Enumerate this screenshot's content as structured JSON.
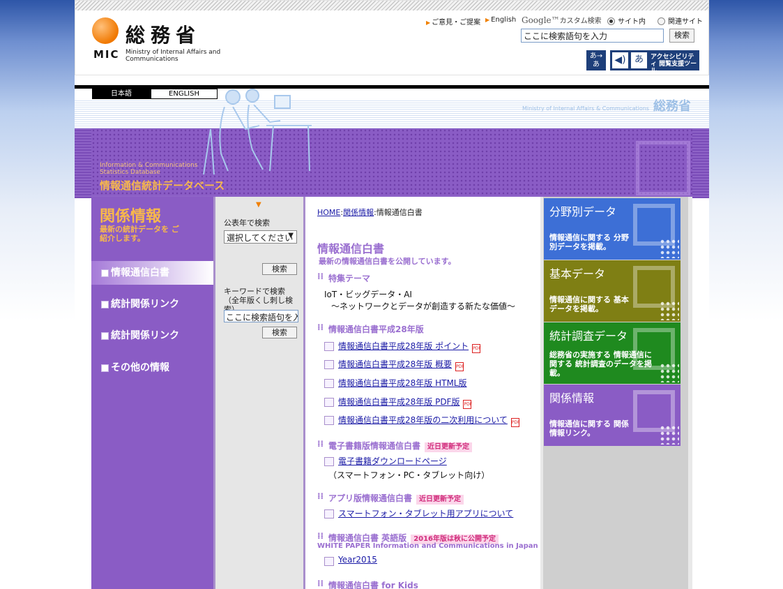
{
  "header": {
    "logo_ja": "総務省",
    "logo_mic": "MIC",
    "logo_en": "Ministry of Internal Affairs and Communications",
    "links": [
      "ご意見・ご提案",
      "English"
    ],
    "google_label": "カスタム検索",
    "google_word": "Google™",
    "radio_site": "サイト内",
    "radio_related": "関連サイト",
    "search_placeholder": "ここに検索語句を入力",
    "search_button": "検索",
    "acc_text_size": "あ→あ",
    "acc_tool": "アクセシビリティ 閲覧支援ツール"
  },
  "banner": {
    "lang_ja": "日本語",
    "lang_en": "ENGLISH",
    "mic_en": "Ministry of Internal Affairs & Communications",
    "mic_ja": "総務省",
    "db_en": "Information & Communications Statistics Database",
    "db_ja": "情報通信統計データベース"
  },
  "left_nav": {
    "title": "関係情報",
    "subtitle": "最新の統計データを ご紹介します。",
    "items": [
      {
        "label": "情報通信白書",
        "active": true
      },
      {
        "label": "統計関係リンク",
        "active": false
      },
      {
        "label": "統計関係リンク",
        "active": false
      },
      {
        "label": "その他の情報",
        "active": false
      }
    ]
  },
  "filter": {
    "year_label": "公表年で検索",
    "year_select": "選択してください",
    "search_button": "検索",
    "keyword_label": "キーワードで検索",
    "keyword_note": "（全年版くし刺し検索）",
    "keyword_placeholder": "ここに検索語句を入力",
    "keyword_button": "検索"
  },
  "content": {
    "breadcrumb": {
      "home": "HOME",
      "sep": ":",
      "rel": "関係情報",
      "current": "情報通信白書"
    },
    "title": "情報通信白書",
    "desc": "最新の情報通信白書を公開しています。",
    "theme_heading": "特集テーマ",
    "theme_line1": "IoT・ビッグデータ・AI",
    "theme_line2": "～ネットワークとデータが創造する新たな価値～",
    "h28_heading": "情報通信白書平成28年版",
    "h28_links": [
      "情報通信白書平成28年版 ポイント",
      "情報通信白書平成28年版 概要",
      "情報通信白書平成28年版 HTML版",
      "情報通信白書平成28年版 PDF版",
      "情報通信白書平成28年版の二次利用について"
    ],
    "ebook_heading": "電子書籍版情報通信白書",
    "ebook_badge": "近日更新予定",
    "ebook_link": "電子書籍ダウンロードページ",
    "ebook_note": "（スマートフォン・PC・タブレット向け）",
    "app_heading": "アプリ版情報通信白書",
    "app_badge": "近日更新予定",
    "app_link": "スマートフォン・タブレット用アプリについて",
    "en_heading": "情報通信白書 英語版",
    "en_badge": "2016年版は秋に公開予定",
    "en_sub": "WHITE PAPER Information and Communications in Japan",
    "en_link": "Year2015",
    "kids_heading": "情報通信白書 for Kids"
  },
  "right_cards": [
    {
      "title": "分野別データ",
      "text": "情報通信に関する 分野別データを掲載。",
      "color": "#3d6fd6"
    },
    {
      "title": "基本データ",
      "text": "情報通信に関する 基本データを掲載。",
      "color": "#7f7f14"
    },
    {
      "title": "統計調査データ",
      "text": "総務省の実施する 情報通信に関する 統計調査のデータを掲載。",
      "color": "#1f8a1f"
    },
    {
      "title": "関係情報",
      "text": "情報通信に関する 関係情報リンク。",
      "color": "#8a5cc5"
    }
  ],
  "colors": {
    "accent_purple": "#8a5cc5",
    "link_blue": "#1a1aa6",
    "orange": "#f08000"
  }
}
